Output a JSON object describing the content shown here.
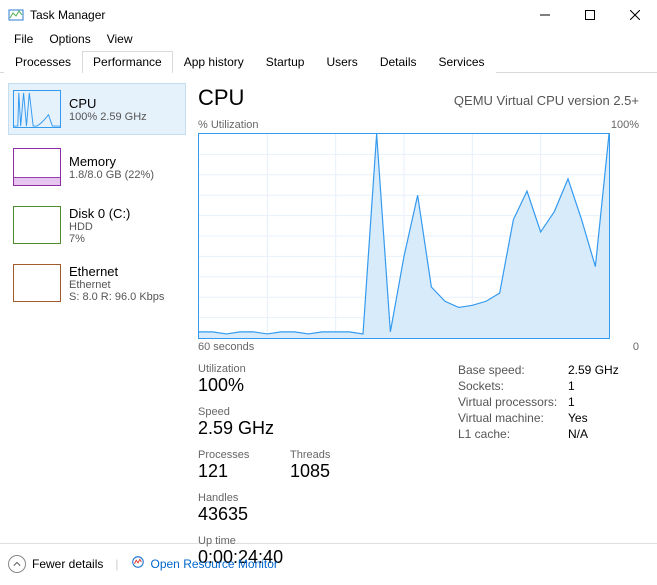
{
  "window": {
    "title": "Task Manager"
  },
  "menu": [
    "File",
    "Options",
    "View"
  ],
  "tabs": [
    "Processes",
    "Performance",
    "App history",
    "Startup",
    "Users",
    "Details",
    "Services"
  ],
  "active_tab": 1,
  "sidebar": [
    {
      "name": "CPU",
      "sub": "100%  2.59 GHz",
      "color": "#339af0",
      "selected": true
    },
    {
      "name": "Memory",
      "sub": "1.8/8.0 GB (22%)",
      "color": "#8e2da5",
      "selected": false
    },
    {
      "name": "Disk 0 (C:)",
      "sub": "HDD\n7%",
      "color": "#4c8c2b",
      "selected": false
    },
    {
      "name": "Ethernet",
      "sub": "Ethernet\nS: 8.0 R: 96.0 Kbps",
      "color": "#a05a2c",
      "selected": false
    }
  ],
  "main": {
    "title": "CPU",
    "subtitle": "QEMU Virtual CPU version 2.5+",
    "chart_top_left": "% Utilization",
    "chart_top_right": "100%",
    "chart_bottom_left": "60 seconds",
    "chart_bottom_right": "0"
  },
  "stats_left": [
    {
      "label": "Utilization",
      "value": "100%"
    },
    {
      "label": "Speed",
      "value": "2.59 GHz"
    },
    {
      "label": "Processes",
      "value": "121"
    },
    {
      "label": "Threads",
      "value": "1085"
    },
    {
      "label": "Handles",
      "value": "43635"
    },
    {
      "label": "Up time",
      "value": "0:00:24:40"
    }
  ],
  "stats_right": [
    {
      "k": "Base speed:",
      "v": "2.59 GHz"
    },
    {
      "k": "Sockets:",
      "v": "1"
    },
    {
      "k": "Virtual processors:",
      "v": "1"
    },
    {
      "k": "Virtual machine:",
      "v": "Yes"
    },
    {
      "k": "L1 cache:",
      "v": "N/A"
    }
  ],
  "footer": {
    "fewer": "Fewer details",
    "link": "Open Resource Monitor"
  },
  "chart_data": {
    "type": "line",
    "title": "CPU % Utilization",
    "xlabel": "seconds ago",
    "ylabel": "% Utilization",
    "ylim": [
      0,
      100
    ],
    "xlim": [
      60,
      0
    ],
    "x": [
      60,
      58,
      56,
      54,
      52,
      50,
      48,
      46,
      44,
      42,
      40,
      38,
      36,
      34,
      32,
      30,
      28,
      26,
      24,
      22,
      20,
      18,
      16,
      14,
      12,
      10,
      8,
      6,
      4,
      2,
      0
    ],
    "values": [
      3,
      3,
      2,
      3,
      3,
      2,
      3,
      3,
      2,
      3,
      3,
      3,
      2,
      100,
      3,
      40,
      70,
      25,
      18,
      15,
      16,
      18,
      22,
      58,
      72,
      52,
      62,
      78,
      58,
      35,
      100
    ]
  }
}
